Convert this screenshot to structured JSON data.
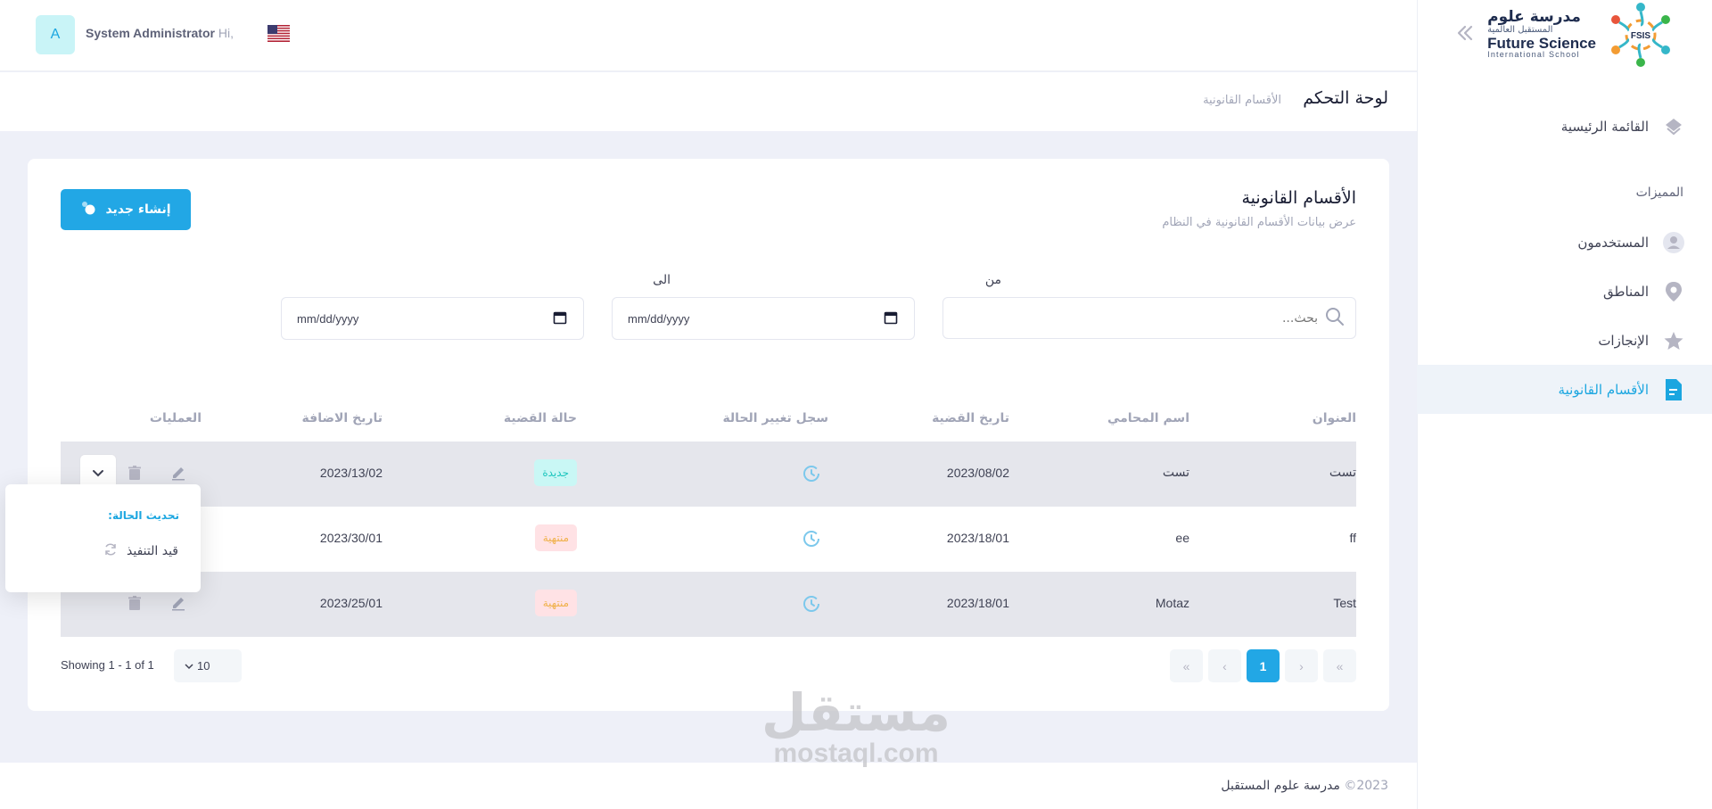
{
  "brand": {
    "name_ar": "مدرسة علوم",
    "tagline_ar": "المستقبل العالمية",
    "name_en": "Future Science",
    "tagline_en": "International School",
    "emblem_text": "FSIS"
  },
  "header": {
    "greeting": "Hi,",
    "user_name": "System Administrator",
    "avatar_letter": "A",
    "language_flag": "us-flag-icon"
  },
  "subheader": {
    "title": "لوحة التحكم",
    "breadcrumb": "الأقسام القانونية"
  },
  "sidebar": {
    "section_label": "المميزات",
    "items": [
      {
        "label": "القائمة الرئيسية",
        "icon": "layers-icon",
        "active": false
      },
      {
        "label": "المستخدمون",
        "icon": "user-icon",
        "active": false
      },
      {
        "label": "المناطق",
        "icon": "map-pin-icon",
        "active": false
      },
      {
        "label": "الإنجازات",
        "icon": "star-icon",
        "active": false
      },
      {
        "label": "الأقسام القانونية",
        "icon": "document-icon",
        "active": true
      }
    ]
  },
  "card": {
    "title": "الأقسام القانونية",
    "subtitle": "عرض بيانات الأقسام القانونية في النظام",
    "create_label": "إنشاء جديد"
  },
  "filters": {
    "search_placeholder": "بحث...",
    "from_label": "من",
    "to_label": "الى",
    "from_value": "mm/dd/yyyy",
    "to_value": "mm/dd/yyyy"
  },
  "table": {
    "headers": {
      "title": "العنوان",
      "lawyer": "اسم المحامي",
      "case_date": "تاريخ القضية",
      "status_log": "سجل تغيير الحالة",
      "status": "حالة القضية",
      "added_date": "تاريخ الاضافة",
      "actions": "العمليات"
    },
    "rows": [
      {
        "title": "تست",
        "lawyer": "تست",
        "case_date": "2023/08/02",
        "status": "جديدة",
        "status_type": "new",
        "added_date": "2023/13/02"
      },
      {
        "title": "ff",
        "lawyer": "ee",
        "case_date": "2023/18/01",
        "status": "منتهية",
        "status_type": "done",
        "added_date": "2023/30/01"
      },
      {
        "title": "Test",
        "lawyer": "Motaz",
        "case_date": "2023/18/01",
        "status": "منتهية",
        "status_type": "done",
        "added_date": "2023/25/01"
      }
    ]
  },
  "dropdown": {
    "title": "تحديث الحالة:",
    "item_label": "قيد التنفيذ"
  },
  "pagination": {
    "current_page": "1",
    "per_page": "10",
    "showing": "Showing 1 - 1 of 1"
  },
  "footer": {
    "year": "2023©",
    "owner": "مدرسة علوم المستقبل"
  },
  "watermark": {
    "ar": "مستقل",
    "en": "mostaql.com"
  },
  "colors": {
    "accent": "#22a7e5",
    "new_badge_bg": "#c9f7f5",
    "new_badge_fg": "#1bc5bd",
    "done_badge_bg": "#ffe2e5",
    "done_badge_fg": "#f0b14a",
    "page_bg": "#eef0f8"
  }
}
